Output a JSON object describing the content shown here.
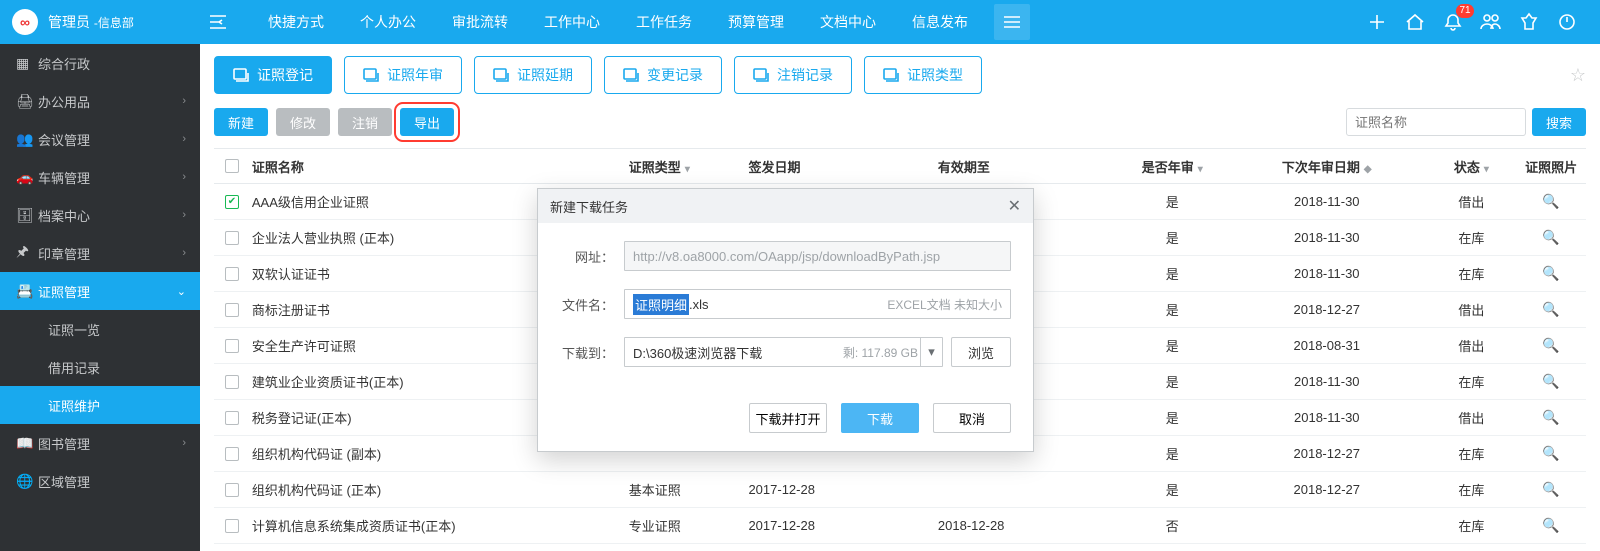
{
  "header": {
    "user": "管理员",
    "dept": "-信息部",
    "nav": [
      "快捷方式",
      "个人办公",
      "审批流转",
      "工作中心",
      "工作任务",
      "预算管理",
      "文档中心",
      "信息发布"
    ],
    "badge": "71"
  },
  "sidebar": {
    "items": [
      {
        "label": "综合行政",
        "expandable": false
      },
      {
        "label": "办公用品",
        "expandable": true
      },
      {
        "label": "会议管理",
        "expandable": true
      },
      {
        "label": "车辆管理",
        "expandable": true
      },
      {
        "label": "档案中心",
        "expandable": true
      },
      {
        "label": "印章管理",
        "expandable": true
      },
      {
        "label": "证照管理",
        "expandable": true,
        "open": true,
        "active": true
      },
      {
        "label": "图书管理",
        "expandable": true
      },
      {
        "label": "区域管理",
        "expandable": false
      }
    ],
    "sub": [
      "证照一览",
      "借用记录",
      "证照维护"
    ],
    "sub_selected": 2
  },
  "tabs": [
    "证照登记",
    "证照年审",
    "证照延期",
    "变更记录",
    "注销记录",
    "证照类型"
  ],
  "actions": {
    "new": "新建",
    "edit": "修改",
    "cancel": "注销",
    "export": "导出"
  },
  "search": {
    "placeholder": "证照名称",
    "button": "搜索"
  },
  "columns": {
    "name": "证照名称",
    "type": "证照类型",
    "issue": "签发日期",
    "valid": "有效期至",
    "annual": "是否年审",
    "next": "下次年审日期",
    "status": "状态",
    "photo": "证照照片"
  },
  "rows": [
    {
      "checked": true,
      "name": "AAA级信用企业证照",
      "type": "",
      "issue": "",
      "valid": "",
      "annual": "是",
      "next": "2018-11-30",
      "status": "借出"
    },
    {
      "checked": false,
      "name": "企业法人营业执照 (正本)",
      "type": "",
      "issue": "",
      "valid": "",
      "annual": "是",
      "next": "2018-11-30",
      "status": "在库"
    },
    {
      "checked": false,
      "name": "双软认证证书",
      "type": "",
      "issue": "",
      "valid": "",
      "annual": "是",
      "next": "2018-11-30",
      "status": "在库"
    },
    {
      "checked": false,
      "name": "商标注册证书",
      "type": "",
      "issue": "",
      "valid": "",
      "annual": "是",
      "next": "2018-12-27",
      "status": "借出"
    },
    {
      "checked": false,
      "name": "安全生产许可证照",
      "type": "",
      "issue": "",
      "valid": "",
      "annual": "是",
      "next": "2018-08-31",
      "status": "借出"
    },
    {
      "checked": false,
      "name": "建筑业企业资质证书(正本)",
      "type": "",
      "issue": "",
      "valid": "",
      "annual": "是",
      "next": "2018-11-30",
      "status": "在库"
    },
    {
      "checked": false,
      "name": "税务登记证(正本)",
      "type": "",
      "issue": "",
      "valid": "",
      "annual": "是",
      "next": "2018-11-30",
      "status": "借出"
    },
    {
      "checked": false,
      "name": "组织机构代码证 (副本)",
      "type": "",
      "issue": "",
      "valid": "",
      "annual": "是",
      "next": "2018-12-27",
      "status": "在库"
    },
    {
      "checked": false,
      "name": "组织机构代码证 (正本)",
      "type": "基本证照",
      "issue": "2017-12-28",
      "valid": "",
      "annual": "是",
      "next": "2018-12-27",
      "status": "在库"
    },
    {
      "checked": false,
      "name": "计算机信息系统集成资质证书(正本)",
      "type": "专业证照",
      "issue": "2017-12-28",
      "valid": "2018-12-28",
      "annual": "否",
      "next": "",
      "status": "在库"
    }
  ],
  "modal": {
    "title": "新建下载任务",
    "url_label": "网址：",
    "url": "http://v8.oa8000.com/OAapp/jsp/downloadByPath.jsp",
    "file_label": "文件名：",
    "file_sel": "证照明细",
    "file_ext": ".xls",
    "file_meta": "EXCEL文档 未知大小",
    "path_label": "下载到：",
    "path": "D:\\360极速浏览器下载",
    "path_free": "剩: 117.89 GB",
    "browse": "浏览",
    "download_open": "下载并打开",
    "download": "下载",
    "cancel": "取消"
  }
}
